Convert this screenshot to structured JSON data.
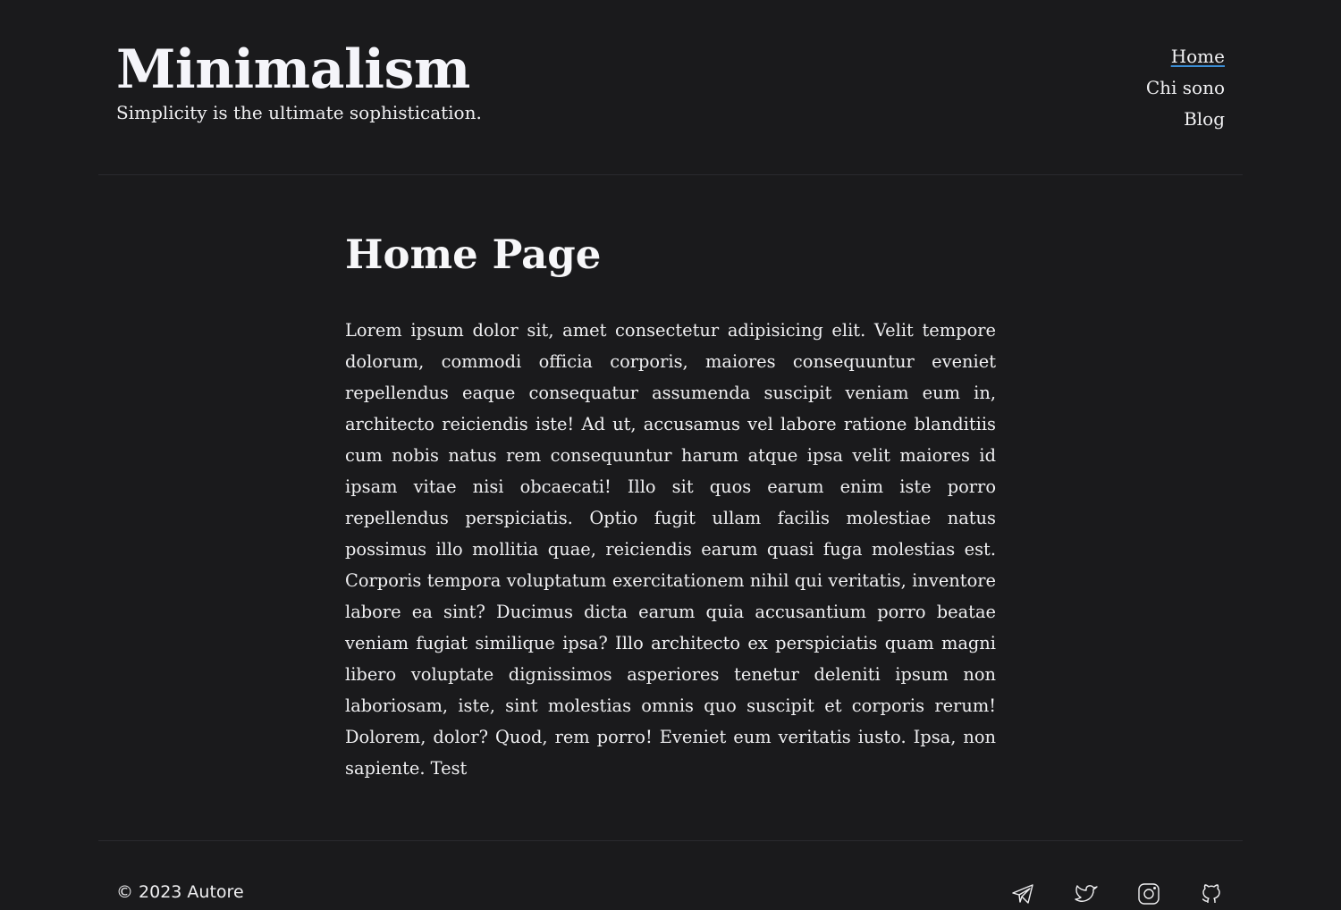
{
  "header": {
    "title": "Minimalism",
    "subtitle": "Simplicity is the ultimate sophistication."
  },
  "nav": {
    "items": [
      {
        "label": "Home",
        "active": true
      },
      {
        "label": "Chi sono",
        "active": false
      },
      {
        "label": "Blog",
        "active": false
      }
    ]
  },
  "main": {
    "title": "Home Page",
    "body": "Lorem ipsum dolor sit, amet consectetur adipisicing elit. Velit tempore dolorum, commodi officia corporis, maiores consequuntur eveniet repellendus eaque consequatur assumenda suscipit veniam eum in, architecto reiciendis iste! Ad ut, accusamus vel labore ratione blanditiis cum nobis natus rem consequuntur harum atque ipsa velit maiores id ipsam vitae nisi obcaecati! Illo sit quos earum enim iste porro repellendus perspiciatis. Optio fugit ullam facilis molestiae natus possimus illo mollitia quae, reiciendis earum quasi fuga molestias est. Corporis tempora voluptatum exercitationem nihil qui veritatis, inventore labore ea sint? Ducimus dicta earum quia accusantium porro beatae veniam fugiat similique ipsa? Illo architecto ex perspiciatis quam magni libero voluptate dignissimos asperiores tenetur deleniti ipsum non laboriosam, iste, sint molestias omnis quo suscipit et corporis rerum! Dolorem, dolor? Quod, rem porro! Eveniet eum veritatis iusto. Ipsa, non sapiente. Test"
  },
  "footer": {
    "copyright": "© 2023 Autore",
    "social_icons": [
      "telegram-icon",
      "twitter-icon",
      "instagram-icon",
      "github-icon"
    ]
  },
  "colors": {
    "background": "#1a1a1c",
    "text": "#f0f0f2",
    "accent": "#3b8ed6",
    "divider": "#2a2a2e"
  }
}
